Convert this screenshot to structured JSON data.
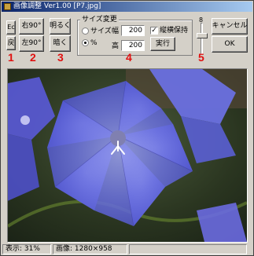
{
  "window": {
    "title": "画像調整 Ver1.00 [P7.jpg]"
  },
  "toolbar": {
    "left_top_label": "Ec",
    "left_bottom_label": "戻",
    "rotate_right_label": "右90°",
    "rotate_left_label": "左90°",
    "brighter_label": "明るく",
    "darker_label": "暗く"
  },
  "size_change": {
    "group_label": "サイズ変更",
    "size_option": "サイズ",
    "percent_option": "%",
    "selected": "%",
    "width_label": "幅",
    "width_value": "200",
    "height_label": "高",
    "height_value": "200",
    "keep_ratio_label": "縦横保持",
    "keep_ratio_checked": true,
    "run_label": "実行"
  },
  "slider": {
    "value": "8"
  },
  "dialog": {
    "cancel_label": "キャンセル",
    "ok_label": "OK"
  },
  "annotations": [
    "1",
    "2",
    "3",
    "4",
    "5"
  ],
  "status": {
    "zoom": "表示: 31%",
    "image_size": "画像: 1280×958"
  }
}
